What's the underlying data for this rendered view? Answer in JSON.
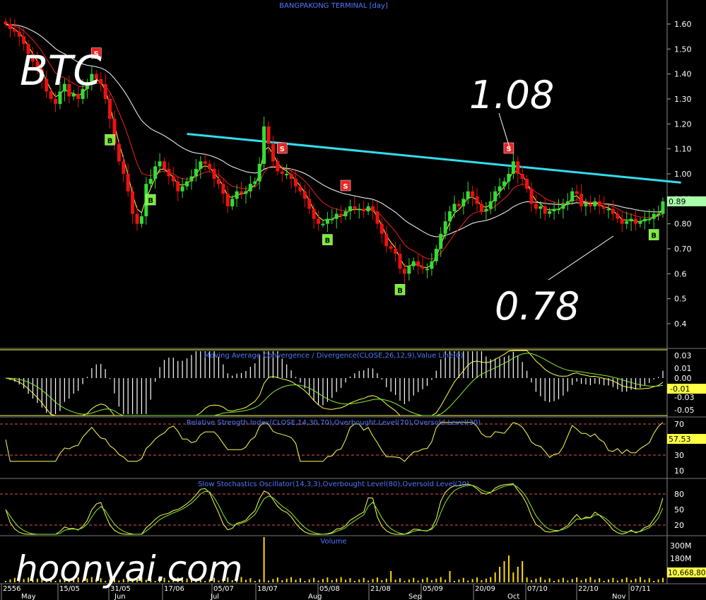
{
  "chart_title": "BANGPAKONG TERMINAL [day]",
  "overlay": {
    "ticker": "BTC",
    "peak": "1.08",
    "low": "0.78",
    "watermark": "hoonyai.com"
  },
  "colors": {
    "bull": "#33dd33",
    "bear": "#ee1111",
    "ma_fast": "#ffff55",
    "ma_mid": "#ee2222",
    "ma_slow": "#ffffff",
    "trend": "#33ddee",
    "signal_sell": "#ee2222",
    "signal_buy": "#77ee33"
  },
  "chart_data": [
    {
      "panel": "price",
      "type": "candlestick",
      "title": "BANGPAKONG TERMINAL [day]",
      "ylim": [
        0.4,
        1.68
      ],
      "yticks": [
        "1.60",
        "1.50",
        "1.40",
        "1.30",
        "1.20",
        "1.10",
        "1.00",
        "0.90",
        "0.80",
        "0.70",
        "0.6",
        "0.5",
        "0.4"
      ],
      "last_value": "0.89",
      "close": [
        1.6,
        1.58,
        1.57,
        1.55,
        1.52,
        1.48,
        1.45,
        1.42,
        1.38,
        1.33,
        1.3,
        1.28,
        1.33,
        1.36,
        1.31,
        1.32,
        1.3,
        1.34,
        1.36,
        1.4,
        1.38,
        1.36,
        1.3,
        1.22,
        1.12,
        1.05,
        1.0,
        0.93,
        0.84,
        0.8,
        0.83,
        0.96,
        0.98,
        1.03,
        1.05,
        1.02,
        0.99,
        0.97,
        0.93,
        0.95,
        0.97,
        0.99,
        1.02,
        1.05,
        1.04,
        1.02,
        0.98,
        0.96,
        0.92,
        0.87,
        0.9,
        0.93,
        0.92,
        0.93,
        0.96,
        0.97,
        1.04,
        1.19,
        1.12,
        1.05,
        1.01,
        1.0,
        1.0,
        0.98,
        0.95,
        0.93,
        0.9,
        0.86,
        0.82,
        0.8,
        0.8,
        0.82,
        0.82,
        0.84,
        0.83,
        0.85,
        0.87,
        0.86,
        0.86,
        0.85,
        0.87,
        0.85,
        0.8,
        0.76,
        0.71,
        0.7,
        0.68,
        0.62,
        0.6,
        0.63,
        0.65,
        0.63,
        0.62,
        0.62,
        0.65,
        0.7,
        0.76,
        0.81,
        0.85,
        0.88,
        0.87,
        0.9,
        0.93,
        0.91,
        0.88,
        0.85,
        0.86,
        0.89,
        0.93,
        0.95,
        0.97,
        1.0,
        1.05,
        1.0,
        0.98,
        0.94,
        0.88,
        0.86,
        0.87,
        0.84,
        0.85,
        0.86,
        0.86,
        0.88,
        0.89,
        0.93,
        0.92,
        0.87,
        0.88,
        0.87,
        0.89,
        0.87,
        0.86,
        0.86,
        0.84,
        0.82,
        0.8,
        0.81,
        0.82,
        0.8,
        0.81,
        0.82,
        0.82,
        0.84,
        0.84,
        0.89
      ],
      "signals": [
        {
          "i": 20,
          "type": "S"
        },
        {
          "i": 23,
          "type": "B"
        },
        {
          "i": 32,
          "type": "B"
        },
        {
          "i": 61,
          "type": "S"
        },
        {
          "i": 75,
          "type": "S"
        },
        {
          "i": 71,
          "type": "B"
        },
        {
          "i": 87,
          "type": "B"
        },
        {
          "i": 111,
          "type": "S"
        },
        {
          "i": 143,
          "type": "B"
        }
      ],
      "trend_line": {
        "from_i": 40,
        "from_v": 1.16,
        "to_i": 149,
        "to_v": 0.965
      }
    },
    {
      "panel": "macd",
      "type": "line",
      "title": "Moving Average Convergence / Divergence(CLOSE,26,12,9),Value Line(0)",
      "ylim": [
        -0.06,
        0.04
      ],
      "yticks": [
        "0.03",
        "0.01",
        "0.00",
        "-0.01",
        "-0.03",
        "-0.05"
      ],
      "last_value": "-0.01"
    },
    {
      "panel": "rsi",
      "type": "line",
      "title": "Relative Strength Index(CLOSE,14,30,70),Overbought Level(70),Oversold Level(30)",
      "ylim": [
        0,
        80
      ],
      "yticks": [
        "70",
        "50",
        "30",
        "10"
      ],
      "levels": [
        70,
        30
      ],
      "last_value": "57.53"
    },
    {
      "panel": "stoch",
      "type": "line",
      "title": "Slow Stochastics Oscillator(14,3,3),Overbought Level(80),Oversold Level(20)",
      "ylim": [
        0,
        100
      ],
      "yticks": [
        "80",
        "50",
        "20"
      ],
      "levels": [
        80,
        20
      ]
    },
    {
      "panel": "volume",
      "type": "bar",
      "title": "Volume",
      "yticks": [
        "300M",
        "180M"
      ],
      "last_value": "10,668,80"
    }
  ],
  "x_labels": [
    "2556",
    "15/05",
    "31/05",
    "17/06",
    "05/07",
    "18/07",
    "05/08",
    "21/08",
    "05/09",
    "20/09",
    "07/10",
    "22/10",
    "07/11"
  ],
  "month_labels": [
    "May",
    "Jun",
    "Jul",
    "Aug",
    "Sep",
    "Oct",
    "Nov"
  ]
}
